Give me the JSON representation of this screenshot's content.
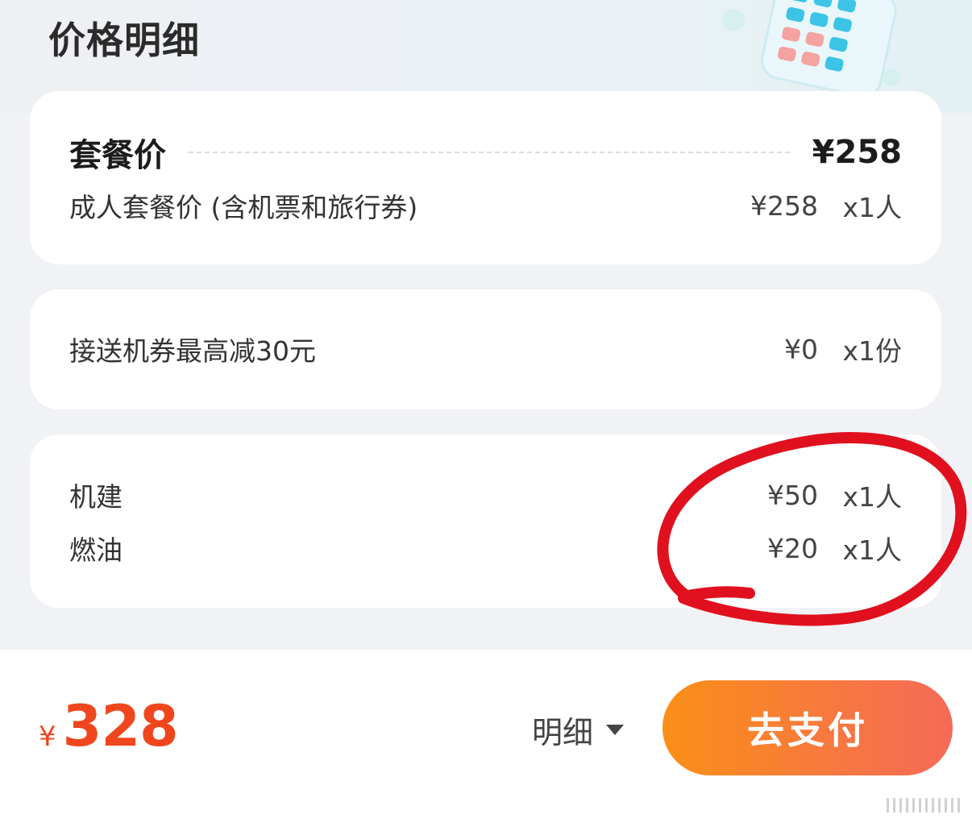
{
  "header": {
    "title": "价格明细"
  },
  "package_card": {
    "title": "套餐价",
    "total": "¥258",
    "items": [
      {
        "label": "成人套餐价 (含机票和旅行券)",
        "price": "¥258",
        "qty": "x1人"
      }
    ]
  },
  "coupon_card": {
    "items": [
      {
        "label": "接送机券最高减30元",
        "price": "¥0",
        "qty": "x1份"
      }
    ]
  },
  "tax_card": {
    "items": [
      {
        "label": "机建",
        "price": "¥50",
        "qty": "x1人"
      },
      {
        "label": "燃油",
        "price": "¥20",
        "qty": "x1人"
      }
    ]
  },
  "footer": {
    "currency": "¥",
    "total": "328",
    "detail_label": "明细",
    "pay_label": "去支付"
  },
  "icons": {
    "header_illustration": "calculator-icon",
    "detail_toggle": "caret-down-icon"
  },
  "colors": {
    "accent": "#f0461e",
    "pay_start": "#fa8f17",
    "pay_end": "#f56a58",
    "annotation": "#e0101e"
  }
}
